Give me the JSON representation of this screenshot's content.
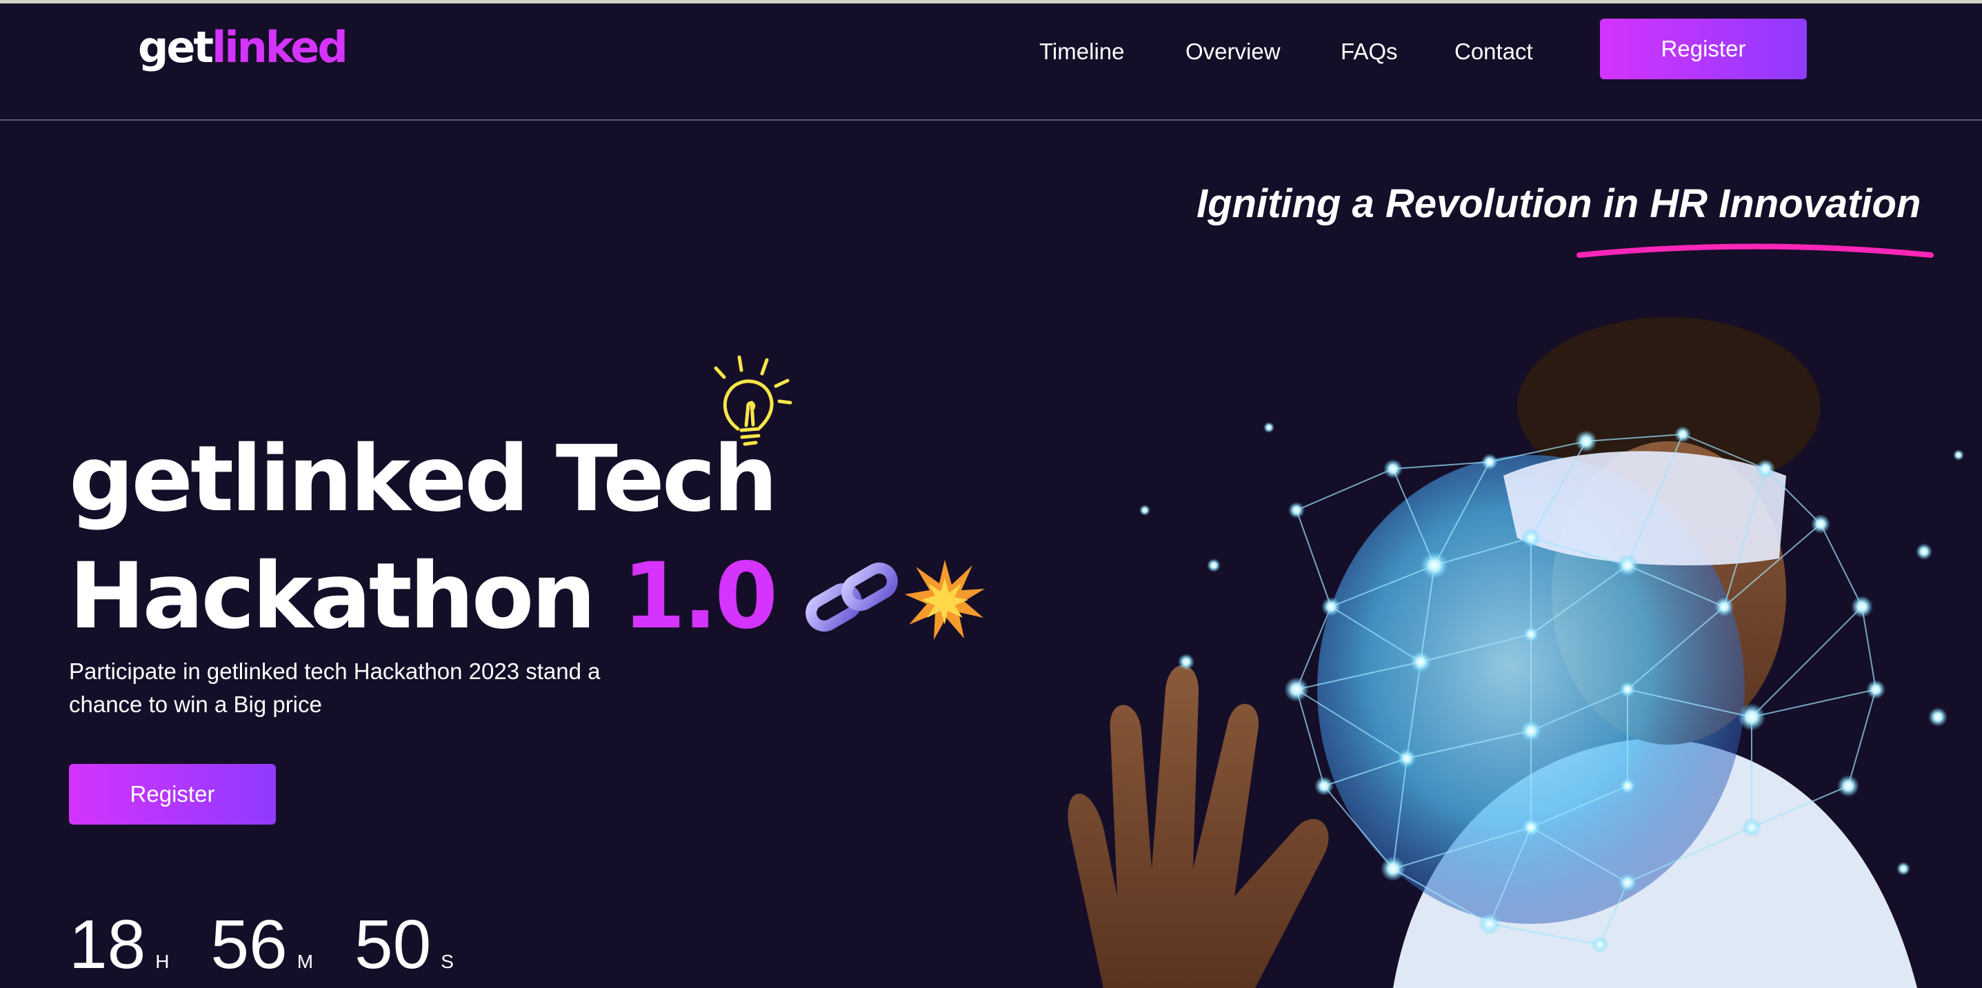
{
  "header": {
    "logo_part1": "get",
    "logo_part2": "linked",
    "nav": [
      "Timeline",
      "Overview",
      "FAQs",
      "Contact"
    ],
    "register_label": "Register"
  },
  "hero": {
    "tagline": "Igniting a Revolution in HR Innovation",
    "title_line1": "getlinked Tech",
    "title_line2": "Hackathon",
    "title_version": "1.0",
    "description": "Participate in getlinked tech Hackathon 2023 stand a chance to win a Big price",
    "register_label": "Register",
    "countdown": {
      "hours": "18",
      "hours_unit": "H",
      "minutes": "56",
      "minutes_unit": "M",
      "seconds": "50",
      "seconds_unit": "S"
    },
    "icons": [
      "lightbulb-icon",
      "link-chain-icon",
      "explosion-icon"
    ]
  },
  "colors": {
    "background": "#150e28",
    "accent": "#d434fe",
    "accent_end": "#903aff",
    "underline": "#ff26b9"
  }
}
